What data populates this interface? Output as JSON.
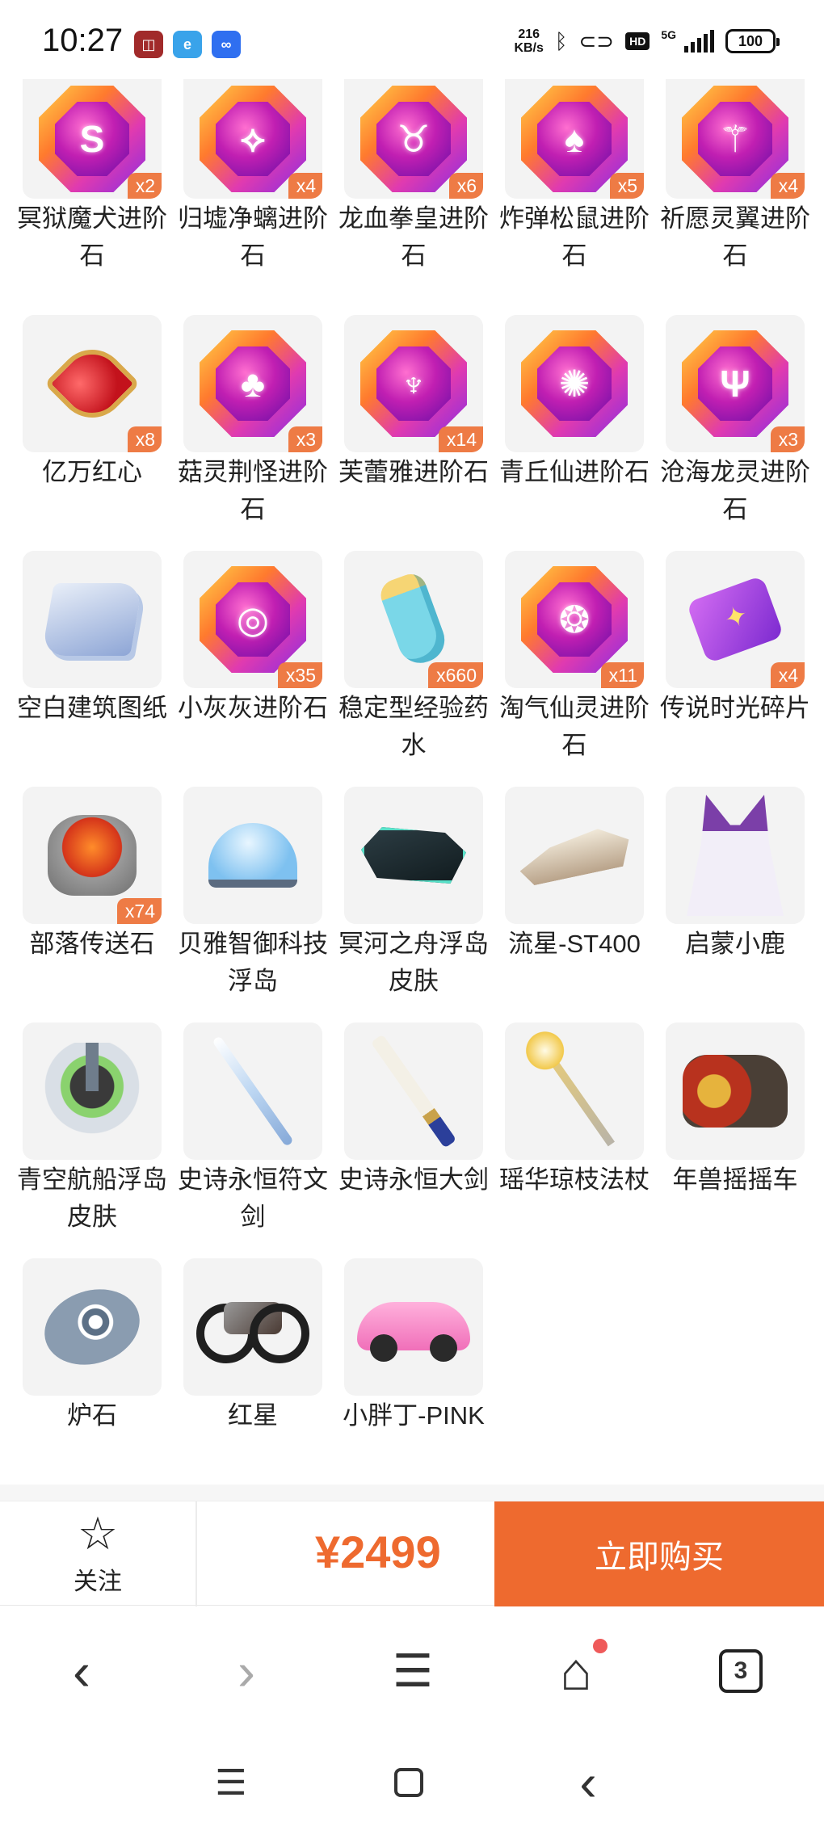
{
  "status_bar": {
    "time": "10:27",
    "net_speed_value": "216",
    "net_speed_unit": "KB/s",
    "network": "5G",
    "hd_label": "HD",
    "battery": "100",
    "app_icons": [
      "bank-app-icon",
      "browser-app-icon",
      "link-app-icon"
    ]
  },
  "items": [
    {
      "name": "冥狱魔犬进阶石",
      "qty": "x2",
      "art": "gem",
      "symbol": "S"
    },
    {
      "name": "归墟净螭进阶石",
      "qty": "x4",
      "art": "gem",
      "symbol": "⟡"
    },
    {
      "name": "龙血拳皇进阶石",
      "qty": "x6",
      "art": "gem",
      "symbol": "♉"
    },
    {
      "name": "炸弹松鼠进阶石",
      "qty": "x5",
      "art": "gem",
      "symbol": "♠"
    },
    {
      "name": "祈愿灵翼进阶石",
      "qty": "x4",
      "art": "gem",
      "symbol": "⚚"
    },
    {
      "name": "亿万红心",
      "qty": "x8",
      "art": "heart",
      "symbol": ""
    },
    {
      "name": "菇灵荆怪进阶石",
      "qty": "x3",
      "art": "gem",
      "symbol": "♣"
    },
    {
      "name": "芙蕾雅进阶石",
      "qty": "x14",
      "art": "gem",
      "symbol": "♆"
    },
    {
      "name": "青丘仙进阶石",
      "qty": "",
      "art": "gem",
      "symbol": "✺"
    },
    {
      "name": "沧海龙灵进阶石",
      "qty": "x3",
      "art": "gem",
      "symbol": "Ψ"
    },
    {
      "name": "空白建筑图纸",
      "qty": "",
      "art": "scroll",
      "symbol": ""
    },
    {
      "name": "小灰灰进阶石",
      "qty": "x35",
      "art": "gem",
      "symbol": "◎"
    },
    {
      "name": "稳定型经验药水",
      "qty": "x660",
      "art": "potion",
      "symbol": ""
    },
    {
      "name": "淘气仙灵进阶石",
      "qty": "x11",
      "art": "gem",
      "symbol": "❂"
    },
    {
      "name": "传说时光碎片",
      "qty": "x4",
      "art": "puzzle",
      "symbol": ""
    },
    {
      "name": "部落传送石",
      "qty": "x74",
      "art": "stone",
      "symbol": ""
    },
    {
      "name": "贝雅智御科技浮岛",
      "qty": "",
      "art": "dome",
      "symbol": ""
    },
    {
      "name": "冥河之舟浮岛皮肤",
      "qty": "",
      "art": "ship",
      "symbol": ""
    },
    {
      "name": "流星-ST400",
      "qty": "",
      "art": "racer",
      "symbol": ""
    },
    {
      "name": "启蒙小鹿",
      "qty": "",
      "art": "deer",
      "symbol": ""
    },
    {
      "name": "青空航船浮岛皮肤",
      "qty": "",
      "art": "island",
      "symbol": ""
    },
    {
      "name": "史诗永恒符文剑",
      "qty": "",
      "art": "sword",
      "symbol": ""
    },
    {
      "name": "史诗永恒大剑",
      "qty": "",
      "art": "greatsword",
      "symbol": ""
    },
    {
      "name": "瑶华琼枝法杖",
      "qty": "",
      "art": "staff",
      "symbol": ""
    },
    {
      "name": "年兽摇摇车",
      "qty": "",
      "art": "beastcar",
      "symbol": ""
    },
    {
      "name": "炉石",
      "qty": "",
      "art": "hearth",
      "symbol": ""
    },
    {
      "name": "红星",
      "qty": "",
      "art": "moto",
      "symbol": ""
    },
    {
      "name": "小胖丁-PINK",
      "qty": "",
      "art": "pinkcar",
      "symbol": ""
    }
  ],
  "buy_bar": {
    "follow_label": "关注",
    "price": "¥2499",
    "buy_label": "立即购买"
  },
  "browser_bar": {
    "back": "‹",
    "forward": "›",
    "menu": "☰",
    "home": "⌂",
    "tabs_count": "3"
  },
  "system_nav": {
    "menu": "☰",
    "back": "‹"
  },
  "colors": {
    "accent": "#ee6a2f",
    "qty_badge": "#ee7b45",
    "thumb_bg": "#f3f3f3"
  }
}
